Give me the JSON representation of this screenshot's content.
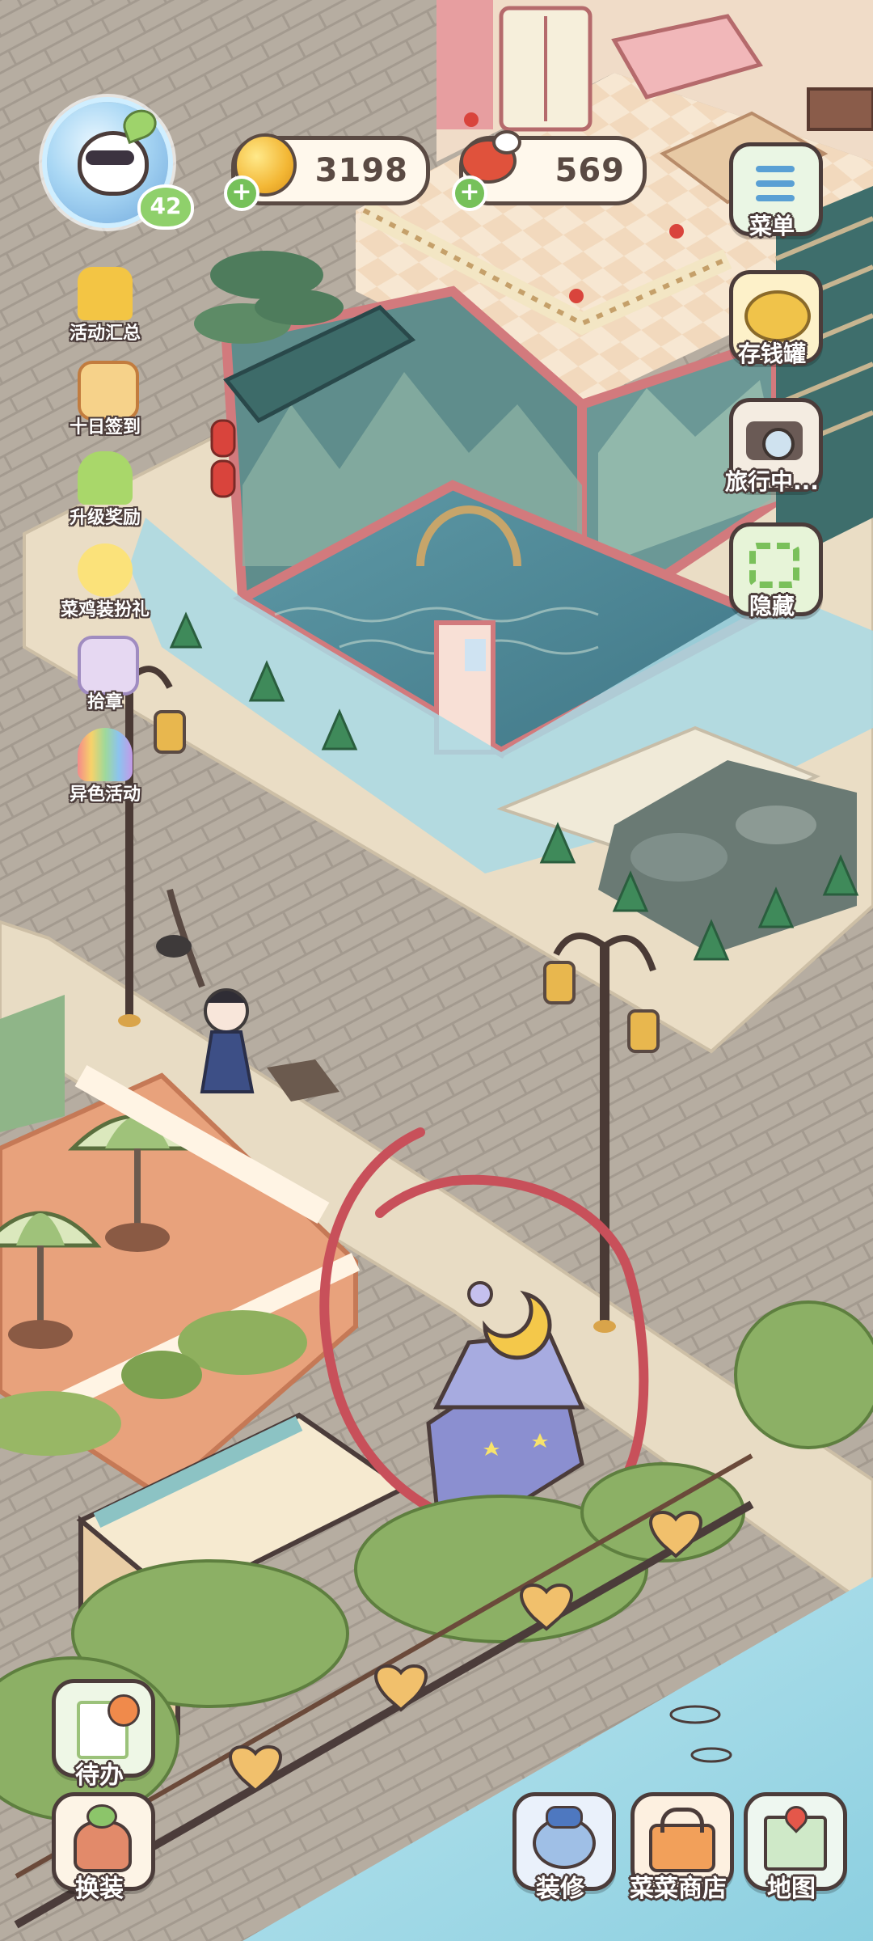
{
  "player": {
    "level": "42"
  },
  "currencies": {
    "coins": "3198",
    "meat": "569"
  },
  "left_menu": [
    {
      "label": "活动汇总",
      "icon": "activity-summary-icon"
    },
    {
      "label": "十日签到",
      "icon": "ten-day-checkin-icon"
    },
    {
      "label": "升级奖励",
      "icon": "level-up-reward-icon"
    },
    {
      "label": "菜鸡装扮礼",
      "icon": "chick-outfit-gift-icon"
    },
    {
      "label": "拾章",
      "icon": "badge-collect-icon"
    },
    {
      "label": "异色活动",
      "icon": "rainbow-event-icon"
    }
  ],
  "right_menu": [
    {
      "label": "菜单",
      "icon": "menu-icon"
    },
    {
      "label": "存钱罐",
      "icon": "piggy-bank-icon"
    },
    {
      "label": "旅行中...",
      "icon": "camera-travel-icon"
    },
    {
      "label": "隐藏",
      "icon": "hide-icon"
    }
  ],
  "bottom_left": [
    {
      "label": "待办",
      "icon": "todo-icon"
    },
    {
      "label": "换装",
      "icon": "dress-up-icon"
    }
  ],
  "bottom_right": [
    {
      "label": "装修",
      "icon": "decorate-icon"
    },
    {
      "label": "菜菜商店",
      "icon": "shop-icon"
    },
    {
      "label": "地图",
      "icon": "map-icon"
    }
  ],
  "colors": {
    "outline": "#4b3c3a",
    "annotation": "#c8505a",
    "water": "#a9d9e4"
  }
}
